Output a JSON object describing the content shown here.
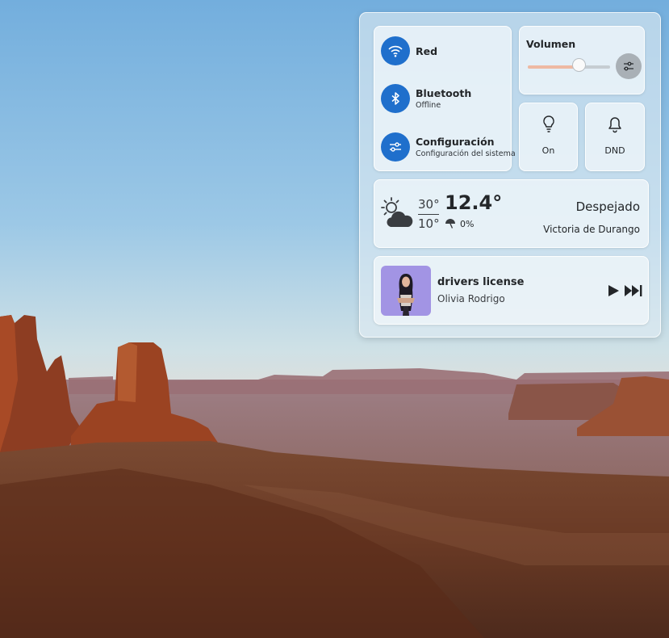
{
  "quick_settings": {
    "network": {
      "label": "Red",
      "icon": "wifi-icon"
    },
    "bluetooth": {
      "label": "Bluetooth",
      "status": "Offline",
      "icon": "bluetooth-icon"
    },
    "settings": {
      "label": "Configuración",
      "description": "Configuración del sistema",
      "icon": "settings-sliders-icon"
    }
  },
  "volume": {
    "title": "Volumen",
    "level": 0.62,
    "mixer_icon": "mixer-icon"
  },
  "toggles": [
    {
      "label": "On",
      "icon": "lightbulb-icon"
    },
    {
      "label": "DND",
      "icon": "bell-icon"
    }
  ],
  "weather": {
    "icon": "partly-cloudy-icon",
    "high": "30°",
    "low": "10°",
    "current_temp": "12.4°",
    "precipitation": "0%",
    "precipitation_icon": "umbrella-icon",
    "condition": "Despejado",
    "location": "Victoria de Durango"
  },
  "media": {
    "title": "drivers license",
    "artist": "Olivia Rodrigo",
    "album_art": "album-art",
    "controls": [
      "play-icon",
      "skip-next-icon"
    ]
  },
  "colors": {
    "accent": "#1f6fcc",
    "volume_fill": "#eeb9a3",
    "album_background": "#a294e4"
  }
}
